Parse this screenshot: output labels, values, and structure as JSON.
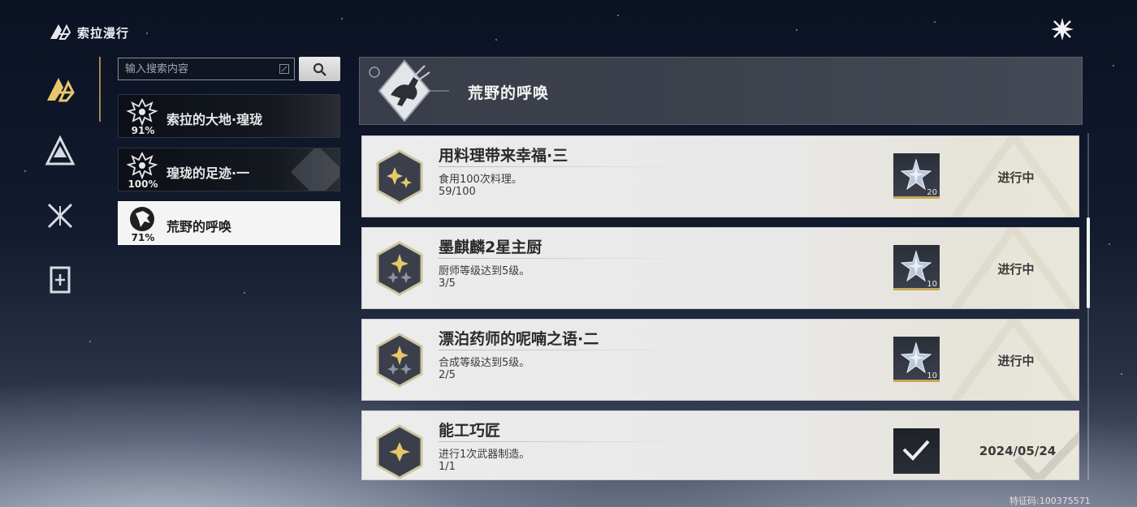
{
  "header": {
    "app_title": "索拉漫行",
    "close_icon": "close-star-icon"
  },
  "nav": {
    "items": [
      {
        "name": "solar-roam-icon",
        "active": true
      },
      {
        "name": "mountain-icon",
        "active": false
      },
      {
        "name": "crossed-swords-icon",
        "active": false
      },
      {
        "name": "book-icon",
        "active": false
      }
    ]
  },
  "search": {
    "placeholder": "输入搜索内容",
    "value": ""
  },
  "categories": [
    {
      "name": "索拉的大地·瑝珑",
      "percent": "91%",
      "progress": 0.91,
      "emblem": "dragon-emblem-icon",
      "active": false
    },
    {
      "name": "瑝珑的足迹·一",
      "percent": "100%",
      "progress": 1.0,
      "emblem": "dragon-emblem-icon",
      "active": false
    },
    {
      "name": "荒野的呼唤",
      "percent": "71%",
      "progress": 0.71,
      "emblem": "beast-head-icon",
      "active": true
    }
  ],
  "banner": {
    "title": "荒野的呼唤",
    "emblem": "galloping-deer-emblem-icon"
  },
  "achievements": [
    {
      "title": "用料理带来幸福·三",
      "desc": "食用100次料理。",
      "progress_text": "59/100",
      "reward_count": "20",
      "status": "进行中",
      "stars": 2
    },
    {
      "title": "墨麒麟2星主厨",
      "desc": "厨师等级达到5级。",
      "progress_text": "3/5",
      "reward_count": "10",
      "status": "进行中",
      "stars": 2
    },
    {
      "title": "漂泊药师的呢喃之语·二",
      "desc": "合成等级达到5级。",
      "progress_text": "2/5",
      "reward_count": "10",
      "status": "进行中",
      "stars": 2
    },
    {
      "title": "能工巧匠",
      "desc": "进行1次武器制造。",
      "progress_text": "1/1",
      "reward_count": "",
      "status": "",
      "date": "2024/05/24",
      "stars": 1,
      "completed": true
    }
  ],
  "watermark_right": "特征码:100375571",
  "colors": {
    "accent_gold": "#c9a553",
    "badge_dark": "#3a3f4b",
    "active_card": "#f4f4f4"
  }
}
